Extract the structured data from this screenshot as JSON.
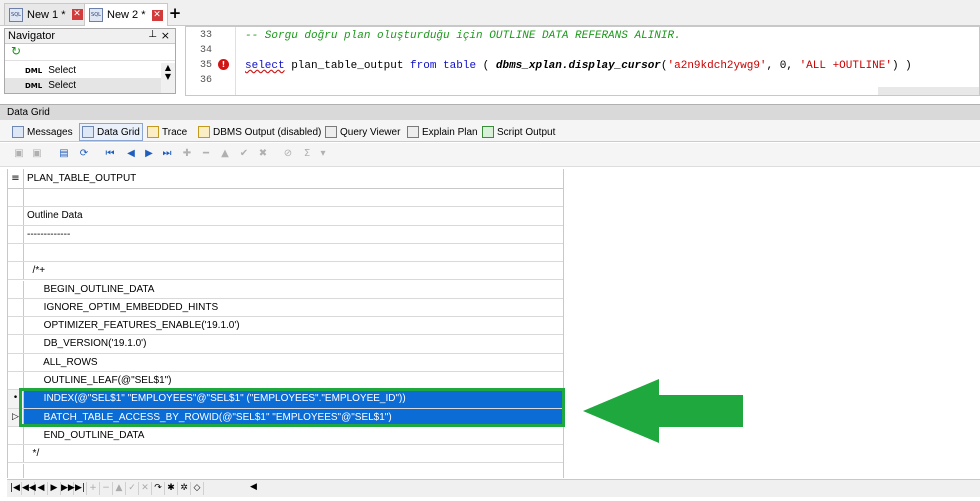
{
  "tabs": [
    {
      "label": "New 1 *",
      "active": false
    },
    {
      "label": "New 2 *",
      "active": true
    }
  ],
  "new_tab_label": "+",
  "navigator": {
    "title": "Navigator",
    "items": [
      {
        "tag": "DML",
        "label": "Select"
      },
      {
        "tag": "DML",
        "label": "Select"
      }
    ]
  },
  "editor": {
    "line_numbers": [
      "33",
      "34",
      "35",
      "36"
    ],
    "comment_line": "-- Sorgu doğru plan oluşturduğu için OUTLINE DATA REFERANS ALINIR.",
    "code": {
      "kw_select": "select",
      "col": " plan_table_output ",
      "kw_from": "from",
      "sp1": " ",
      "kw_table": "table",
      "open": " ( ",
      "fn": "dbms_xplan.display_cursor",
      "p1": "(",
      "s1": "'a2n9kdch2ywg9'",
      "c1": ", ",
      "n1": "0",
      "c2": ", ",
      "s2": "'ALL +OUTLINE'",
      "close": ") )"
    }
  },
  "data_grid": {
    "title": "Data Grid",
    "tabs": [
      {
        "label": "Messages"
      },
      {
        "label": "Data Grid",
        "active": true
      },
      {
        "label": "Trace"
      },
      {
        "label": "DBMS Output (disabled)"
      },
      {
        "label": "Query Viewer"
      },
      {
        "label": "Explain Plan"
      },
      {
        "label": "Script Output"
      }
    ],
    "column": "PLAN_TABLE_OUTPUT",
    "rows": [
      "",
      "Outline Data",
      "-------------",
      "",
      "  /*+",
      "      BEGIN_OUTLINE_DATA",
      "      IGNORE_OPTIM_EMBEDDED_HINTS",
      "      OPTIMIZER_FEATURES_ENABLE('19.1.0')",
      "      DB_VERSION('19.1.0')",
      "      ALL_ROWS",
      "      OUTLINE_LEAF(@\"SEL$1\")",
      "      INDEX(@\"SEL$1\" \"EMPLOYEES\"@\"SEL$1\" (\"EMPLOYEES\".\"EMPLOYEE_ID\"))",
      "      BATCH_TABLE_ACCESS_BY_ROWID(@\"SEL$1\" \"EMPLOYEES\"@\"SEL$1\")",
      "      END_OUTLINE_DATA",
      "  */"
    ],
    "selected_rows": [
      11,
      12
    ],
    "current_row_marker": "•",
    "highlight_color": "#1fa83e"
  },
  "annotation": {
    "arrow_color": "#1fa83e"
  }
}
